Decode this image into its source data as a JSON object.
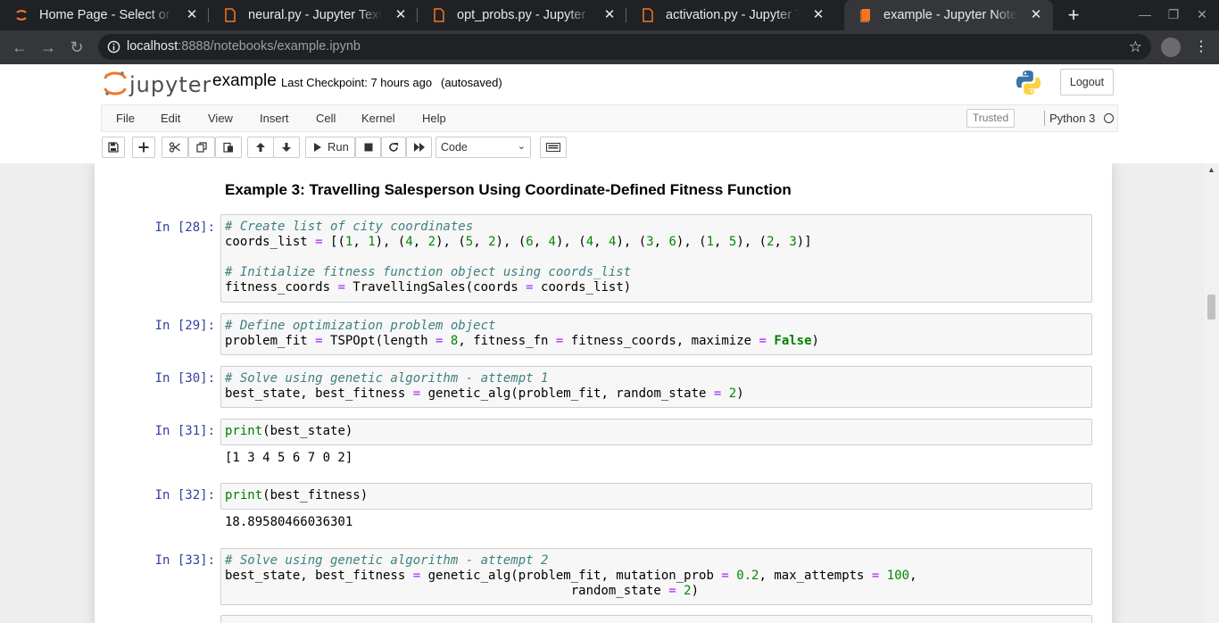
{
  "browser": {
    "tabs": [
      {
        "title": "Home Page - Select or create a notebook",
        "icon": "jupyter-logo-icon"
      },
      {
        "title": "neural.py - Jupyter Text Editor",
        "icon": "file-icon"
      },
      {
        "title": "opt_probs.py - Jupyter Text Editor",
        "icon": "file-icon"
      },
      {
        "title": "activation.py - Jupyter Text Editor",
        "icon": "file-icon"
      },
      {
        "title": "example - Jupyter Notebook",
        "icon": "notebook-icon",
        "active": true
      }
    ],
    "new_tab_label": "+",
    "url_host": "localhost",
    "url_rest": ":8888/notebooks/example.ipynb"
  },
  "jupyter": {
    "logo_text": "jupyter",
    "notebook_name": "example",
    "checkpoint": "Last Checkpoint: 7 hours ago",
    "autosave": "(autosaved)",
    "logout_label": "Logout",
    "menu": [
      "File",
      "Edit",
      "View",
      "Insert",
      "Cell",
      "Kernel",
      "Help"
    ],
    "trusted_label": "Trusted",
    "kernel_name": "Python 3",
    "run_label": "Run",
    "cell_type": "Code"
  },
  "notebook": {
    "heading": "Example 3: Travelling Salesperson Using Coordinate-Defined Fitness Function",
    "cells": [
      {
        "prompt": "In [28]:"
      },
      {
        "prompt": "In [29]:"
      },
      {
        "prompt": "In [30]:"
      },
      {
        "prompt": "In [31]:",
        "output": "[1 3 4 5 6 7 0 2]"
      },
      {
        "prompt": "In [32]:",
        "output": "18.89580466036301"
      },
      {
        "prompt": "In [33]:"
      }
    ],
    "code": {
      "c28_l1": "# Create list of city coordinates",
      "c28_l4": "# Initialize fitness function object using coords_list",
      "c29_l1": "# Define optimization problem object",
      "c30_l1": "# Solve using genetic algorithm - attempt 1",
      "c33_l1": "# Solve using genetic algorithm - attempt 2"
    }
  },
  "colors": {
    "prompt": "#303f9f",
    "comment": "#408080",
    "operator": "#aa22ff",
    "number": "#008800",
    "keyword": "#008000"
  }
}
